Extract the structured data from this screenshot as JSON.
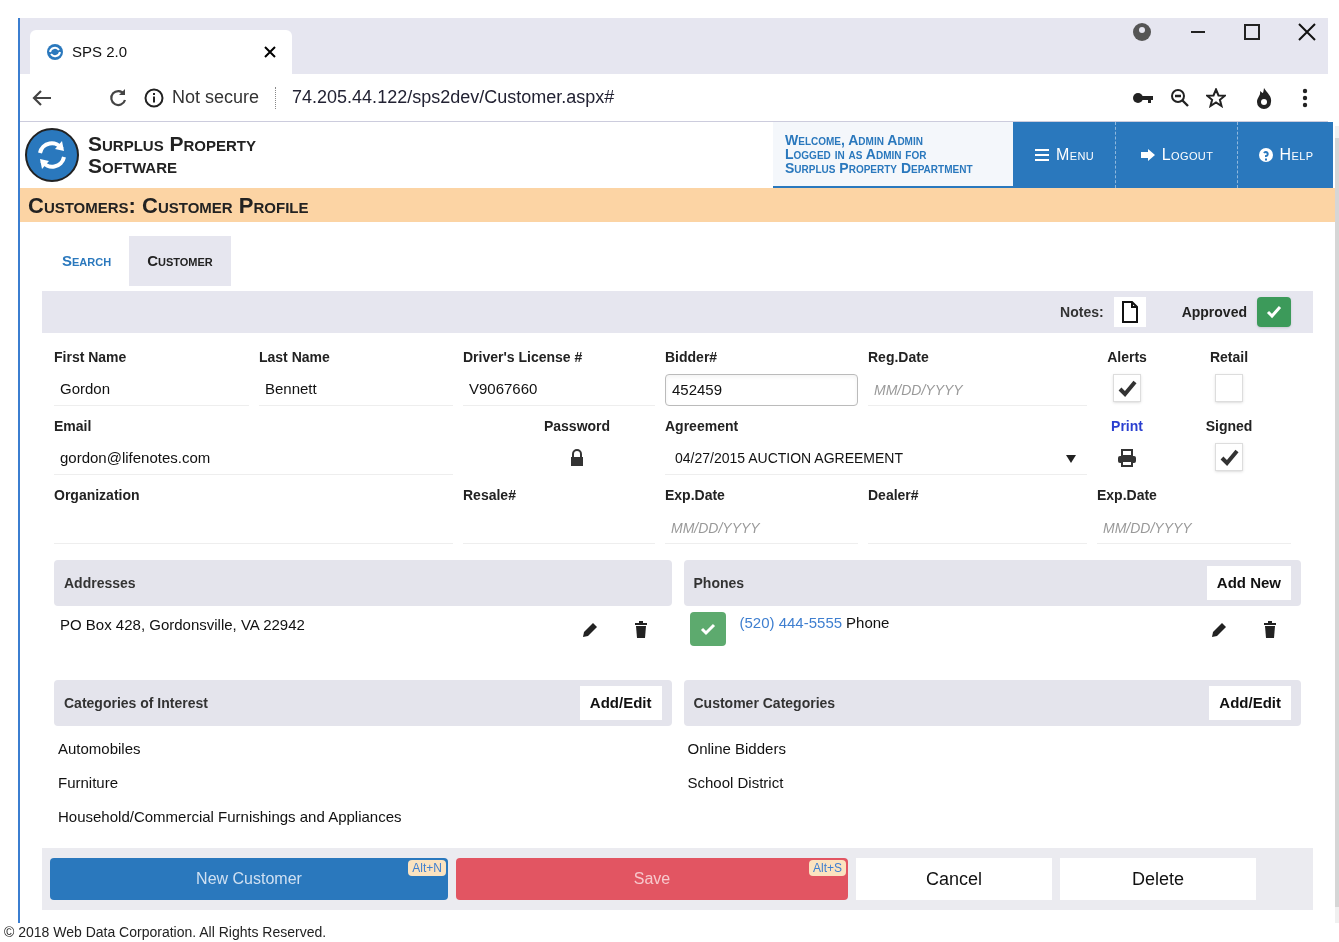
{
  "browser": {
    "tab_title": "SPS 2.0",
    "security_label": "Not secure",
    "url": "74.205.44.122/sps2dev/Customer.aspx#"
  },
  "header": {
    "logo_lines": [
      "Surplus Property",
      "Software"
    ],
    "welcome_lines": [
      "Welcome, Admin Admin",
      "Logged in as Admin for",
      "Surplus Property Department"
    ],
    "nav": [
      {
        "label": "Menu",
        "kind": "menu"
      },
      {
        "label": "Logout",
        "kind": "logout"
      },
      {
        "label": "Help",
        "kind": "help"
      }
    ]
  },
  "page_title": "Customers: Customer Profile",
  "tabs": [
    {
      "label": "Search",
      "selected": false
    },
    {
      "label": "Customer",
      "selected": true
    }
  ],
  "toolbar": {
    "notes_label": "Notes:",
    "approved_label": "Approved",
    "approved": true
  },
  "form_rows": [
    [
      {
        "label": "First Name",
        "kind": "text",
        "value": "Gordon"
      },
      {
        "label": "Last Name",
        "kind": "text",
        "value": "Bennett"
      },
      {
        "label": "Driver's License #",
        "kind": "text",
        "value": "V9067660"
      },
      {
        "label": "Bidder#",
        "kind": "input",
        "value": "452459"
      },
      {
        "label": "Reg.Date",
        "kind": "date",
        "placeholder": "MM/DD/YYYY"
      },
      {
        "label": "Alerts",
        "kind": "check",
        "checked": true
      },
      {
        "label": "Retail",
        "kind": "check",
        "checked": false
      }
    ],
    [
      {
        "label": "Email",
        "kind": "text",
        "value": "gordon@lifenotes.com"
      },
      {
        "label": "Password",
        "kind": "password"
      },
      {
        "label": "Agreement",
        "kind": "select",
        "value": "04/27/2015 AUCTION AGREEMENT"
      },
      {
        "label": "Print",
        "kind": "print"
      },
      {
        "label": "Signed",
        "kind": "check",
        "checked": true
      }
    ],
    [
      {
        "label": "Organization",
        "kind": "text"
      },
      {
        "label": "Resale#",
        "kind": "text"
      },
      {
        "label": "Exp.Date",
        "kind": "date",
        "placeholder": "MM/DD/YYYY"
      },
      {
        "label": "Dealer#",
        "kind": "text"
      },
      {
        "label": "Exp.Date",
        "kind": "date",
        "placeholder": "MM/DD/YYYY"
      }
    ]
  ],
  "addresses": {
    "title": "Addresses",
    "items": [
      "PO Box 428, Gordonsville, VA 22942"
    ]
  },
  "phones": {
    "title": "Phones",
    "button": "Add New",
    "items": [
      {
        "number": "(520) 444-5555",
        "type": "Phone",
        "checked": true
      }
    ]
  },
  "categories_of_interest": {
    "title": "Categories of Interest",
    "button": "Add/Edit",
    "items": [
      "Automobiles",
      "Furniture",
      "Household/Commercial Furnishings and Appliances"
    ]
  },
  "customer_categories": {
    "title": "Customer Categories",
    "button": "Add/Edit",
    "items": [
      "Online Bidders",
      "School District"
    ]
  },
  "actions": [
    {
      "label": "New Customer",
      "kind": "primary",
      "shortcut": "Alt+N"
    },
    {
      "label": "Save",
      "kind": "danger",
      "shortcut": "Alt+S"
    },
    {
      "label": "Cancel",
      "kind": "default"
    },
    {
      "label": "Delete",
      "kind": "default"
    }
  ],
  "footer": "© 2018 Web Data Corporation. All Rights Reserved."
}
